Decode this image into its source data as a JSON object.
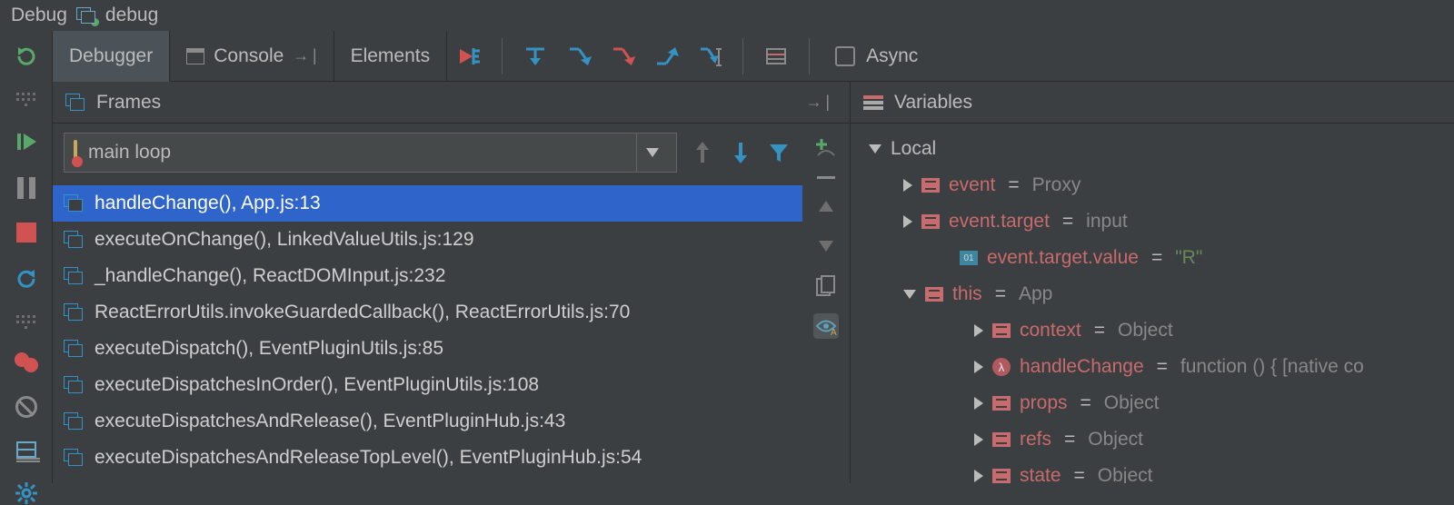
{
  "title": {
    "label": "Debug",
    "config_name": "debug"
  },
  "tabs": {
    "debugger": "Debugger",
    "console": "Console",
    "elements": "Elements"
  },
  "toolbar": {
    "async_label": "Async"
  },
  "panels": {
    "frames_title": "Frames",
    "variables_title": "Variables"
  },
  "thread_selector": {
    "label": "main loop"
  },
  "frames": [
    {
      "text": "handleChange(), App.js:13",
      "selected": true
    },
    {
      "text": "executeOnChange(), LinkedValueUtils.js:129",
      "selected": false
    },
    {
      "text": "_handleChange(), ReactDOMInput.js:232",
      "selected": false
    },
    {
      "text": "ReactErrorUtils.invokeGuardedCallback(), ReactErrorUtils.js:70",
      "selected": false
    },
    {
      "text": "executeDispatch(), EventPluginUtils.js:85",
      "selected": false
    },
    {
      "text": "executeDispatchesInOrder(), EventPluginUtils.js:108",
      "selected": false
    },
    {
      "text": "executeDispatchesAndRelease(), EventPluginHub.js:43",
      "selected": false
    },
    {
      "text": "executeDispatchesAndReleaseTopLevel(), EventPluginHub.js:54",
      "selected": false
    }
  ],
  "variables": {
    "scope": "Local",
    "items": [
      {
        "kind": "obj",
        "indent": 2,
        "arrow": "right",
        "name": "event",
        "value": "Proxy"
      },
      {
        "kind": "obj",
        "indent": 2,
        "arrow": "right",
        "name": "event.target",
        "value": "input"
      },
      {
        "kind": "prim",
        "indent": 3,
        "arrow": "",
        "name": "event.target.value",
        "value": "\"R\"",
        "str": true
      },
      {
        "kind": "obj",
        "indent": 2,
        "arrow": "down",
        "name": "this",
        "value": "App"
      },
      {
        "kind": "obj",
        "indent": 4,
        "arrow": "right",
        "name": "context",
        "value": "Object"
      },
      {
        "kind": "func",
        "indent": 4,
        "arrow": "right",
        "name": "handleChange",
        "value": "function () { [native co"
      },
      {
        "kind": "obj",
        "indent": 4,
        "arrow": "right",
        "name": "props",
        "value": "Object"
      },
      {
        "kind": "obj",
        "indent": 4,
        "arrow": "right",
        "name": "refs",
        "value": "Object"
      },
      {
        "kind": "obj",
        "indent": 4,
        "arrow": "right",
        "name": "state",
        "value": "Object"
      }
    ]
  }
}
